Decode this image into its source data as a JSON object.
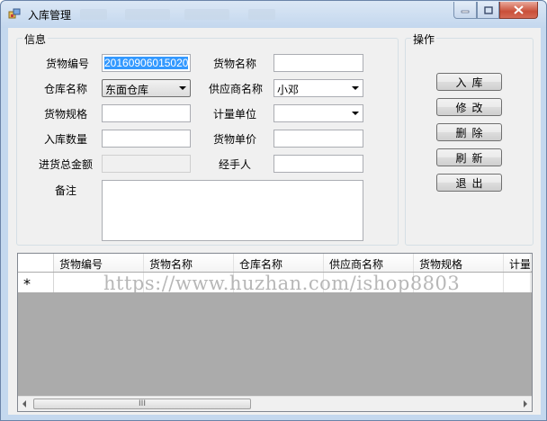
{
  "window": {
    "title": "入库管理",
    "controls": {
      "minimize": "minimize",
      "maximize": "maximize",
      "close": "close"
    }
  },
  "info_group": {
    "legend": "信息",
    "fields": {
      "goods_no": {
        "label": "货物编号",
        "value": "20160906015020"
      },
      "goods_name": {
        "label": "货物名称",
        "value": ""
      },
      "warehouse": {
        "label": "仓库名称",
        "value": "东面仓库"
      },
      "supplier": {
        "label": "供应商名称",
        "value": "小邓"
      },
      "spec": {
        "label": "货物规格",
        "value": ""
      },
      "unit": {
        "label": "计量单位",
        "value": ""
      },
      "quantity": {
        "label": "入库数量",
        "value": ""
      },
      "unit_price": {
        "label": "货物单价",
        "value": ""
      },
      "total_amount": {
        "label": "进货总金额",
        "value": ""
      },
      "handler": {
        "label": "经手人",
        "value": ""
      },
      "remark": {
        "label": "备注",
        "value": ""
      }
    }
  },
  "ops_group": {
    "legend": "操作",
    "buttons": {
      "stock_in": "入库",
      "modify": "修改",
      "delete": "删除",
      "refresh": "刷新",
      "exit": "退出"
    }
  },
  "grid": {
    "columns": [
      "货物编号",
      "货物名称",
      "仓库名称",
      "供应商名称",
      "货物规格",
      "计量"
    ],
    "new_row_marker": "*",
    "watermark": "https://www.huzhan.com/ishop8803",
    "scroll_thumb_grip": "III"
  },
  "colors": {
    "window_frame": "#c4d8ee",
    "client_bg": "#f0f0f0",
    "grid_bg": "#ababab",
    "selection": "#3399ff"
  }
}
